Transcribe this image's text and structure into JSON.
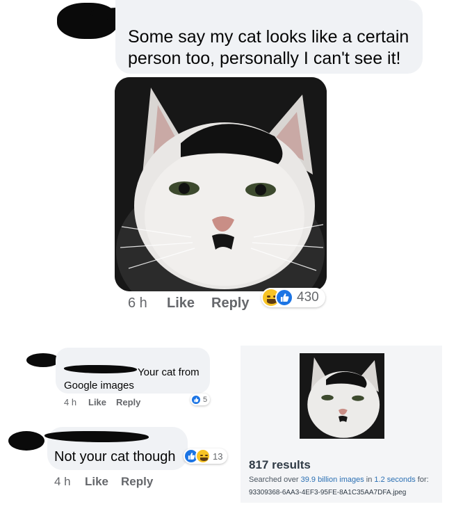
{
  "post": {
    "comment_text_line1": "Some say my cat looks like a certain",
    "comment_text_line2": "person too, personally I can't see it!",
    "time": "6 h",
    "like_label": "Like",
    "reply_label": "Reply",
    "reaction_count": "430"
  },
  "reply1": {
    "text_line1": "Your cat from",
    "text_line2": "Google images",
    "time": "4 h",
    "like_label": "Like",
    "reply_label": "Reply",
    "reaction_count": "5"
  },
  "reply2": {
    "text": "Not your cat though",
    "time": "4 h",
    "like_label": "Like",
    "reply_label": "Reply",
    "reaction_count": "13"
  },
  "search": {
    "results": "817 results",
    "searched_prefix": "Searched over ",
    "searched_count": "39.9 billion images",
    "searched_mid": " in ",
    "searched_time": "1.2 seconds",
    "searched_suffix": " for:",
    "filename": "93309368-6AA3-4EF3-95FE-8A1C35AA7DFA.jpeg"
  },
  "colors": {
    "bubble": "#f0f2f5",
    "meta_text": "#65676b",
    "like_blue": "#1b74e4",
    "haha_yellow": "#f7c325",
    "search_link": "#2a6fb3",
    "search_panel": "#f4f5f7"
  },
  "icons": [
    "haha-reaction-icon",
    "like-reaction-icon"
  ]
}
